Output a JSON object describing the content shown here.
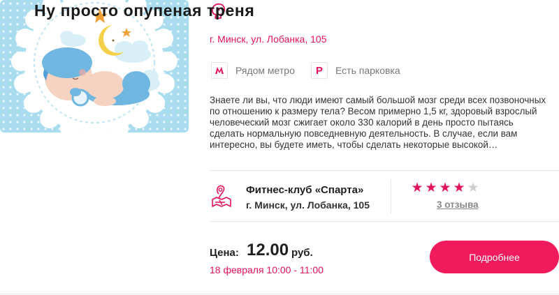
{
  "event": {
    "title": "Ну просто опупеная треня",
    "address": "г. Минск, ул. Лобанка, 105",
    "title_icon": "boxing-glove-icon",
    "features": [
      {
        "icon": "metro-icon",
        "label": "Рядом метро"
      },
      {
        "icon": "parking-icon",
        "label": "Есть парковка"
      }
    ],
    "description_lines": [
      "Знаете ли вы, что люди имеют самый большой мозг среди всех позвоночных",
      "по отношению к размеру тела? Весом примерно 1,5 кг, здоровый взрослый",
      "человеческий мозг сжигает около 330 калорий в день просто пытаясь",
      "сделать нормальную повседневную деятельность. В случае, если вам",
      "интересно, вы будете иметь, чтобы сделать некоторые высокой…"
    ]
  },
  "club": {
    "icon": "map-pin-icon",
    "name": "Фитнес-клуб «Спарта»",
    "address": "г. Минск, ул. Лобанка, 105",
    "rating": 4,
    "rating_max": 5,
    "reviews_label": "3 отзыва"
  },
  "price": {
    "label": "Цена:",
    "value": "12.00",
    "currency": "руб.",
    "date": "18 февраля 10:00 - 11:00"
  },
  "actions": {
    "details_label": "Подробнее"
  },
  "colors": {
    "accent": "#e2135a",
    "button": "#f01a5d",
    "thumbnail_bg": "#a9dcef"
  }
}
